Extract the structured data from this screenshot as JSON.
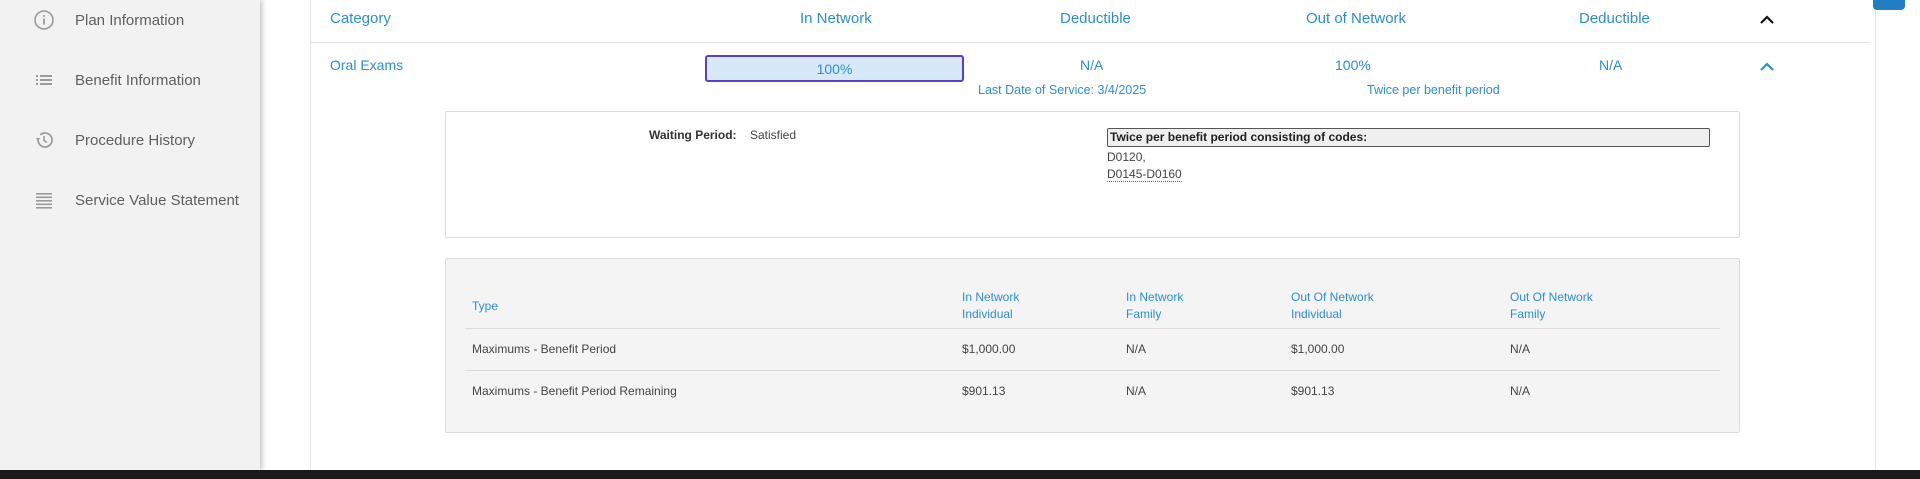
{
  "sidebar": {
    "items": [
      {
        "label": "Plan Information",
        "icon": "info-icon"
      },
      {
        "label": "Benefit Information",
        "icon": "list-icon"
      },
      {
        "label": "Procedure History",
        "icon": "history-icon"
      },
      {
        "label": "Service Value Statement",
        "icon": "statement-icon"
      }
    ]
  },
  "header": {
    "category": "Category",
    "in_network": "In Network",
    "deductible_in": "Deductible",
    "out_of_network": "Out of Network",
    "deductible_out": "Deductible"
  },
  "row": {
    "category": "Oral Exams",
    "in_network": "100%",
    "deductible_in": "N/A",
    "out_of_network": "100%",
    "deductible_out": "N/A",
    "last_service": "Last Date of Service: 3/4/2025",
    "frequency": "Twice per benefit period"
  },
  "details": {
    "waiting_period_label": "Waiting Period:",
    "waiting_period_value": "Satisfied",
    "frequency_title": "Twice per benefit period consisting of codes:",
    "codes": [
      "D0120,",
      "D0145-D0160"
    ]
  },
  "maximums": {
    "headers": {
      "type": "Type",
      "in_ind_1": "In Network",
      "in_ind_2": "Individual",
      "in_fam_1": "In Network",
      "in_fam_2": "Family",
      "out_ind_1": "Out Of Network",
      "out_ind_2": "Individual",
      "out_fam_1": "Out Of Network",
      "out_fam_2": "Family"
    },
    "rows": [
      {
        "type": "Maximums - Benefit Period",
        "in_ind": "$1,000.00",
        "in_fam": "N/A",
        "out_ind": "$1,000.00",
        "out_fam": "N/A"
      },
      {
        "type": "Maximums - Benefit Period Remaining",
        "in_ind": "$901.13",
        "in_fam": "N/A",
        "out_ind": "$901.13",
        "out_fam": "N/A"
      }
    ]
  },
  "colors": {
    "accent": "#2b8ed0",
    "focus_border": "#5b3ecf",
    "sidebar_bg": "#f2f2f2"
  }
}
